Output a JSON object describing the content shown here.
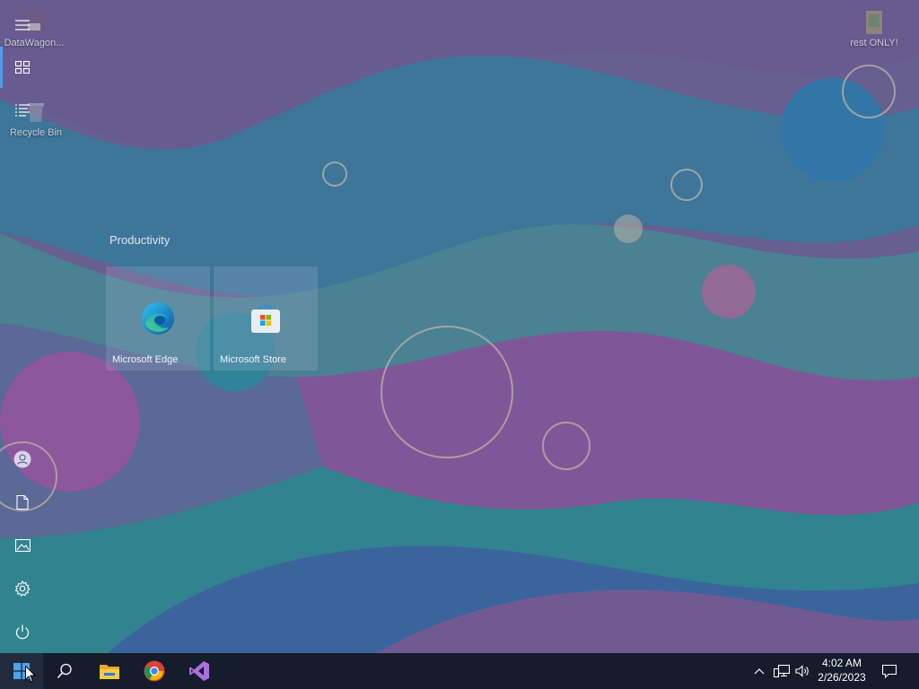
{
  "desktop": {
    "icons": [
      {
        "label": "DataWagon..."
      },
      {
        "label": "Recycle Bin"
      },
      {
        "label": "rest ONLY!"
      }
    ]
  },
  "start_menu": {
    "rail": [
      {
        "icon": "hamburger-menu-icon"
      },
      {
        "icon": "all-apps-icon"
      },
      {
        "icon": "list-icon"
      },
      {
        "icon": "user-account-icon"
      },
      {
        "icon": "documents-icon"
      },
      {
        "icon": "pictures-icon"
      },
      {
        "icon": "settings-gear-icon"
      },
      {
        "icon": "power-icon"
      }
    ],
    "group_title": "Productivity",
    "tiles": [
      {
        "label": "Microsoft Edge",
        "icon": "edge-icon"
      },
      {
        "label": "Microsoft Store",
        "icon": "store-icon"
      }
    ]
  },
  "taskbar": {
    "apps": [
      {
        "icon": "windows-start-icon"
      },
      {
        "icon": "search-icon"
      },
      {
        "icon": "file-explorer-icon"
      },
      {
        "icon": "chrome-icon"
      },
      {
        "icon": "visual-studio-icon"
      }
    ],
    "tray": {
      "time": "4:02 AM",
      "date": "2/26/2023"
    }
  },
  "colors": {
    "taskbar": "#151c2b",
    "accent": "#4d9df0",
    "teal": "#2b9c99",
    "purple": "#8a5aa6"
  }
}
